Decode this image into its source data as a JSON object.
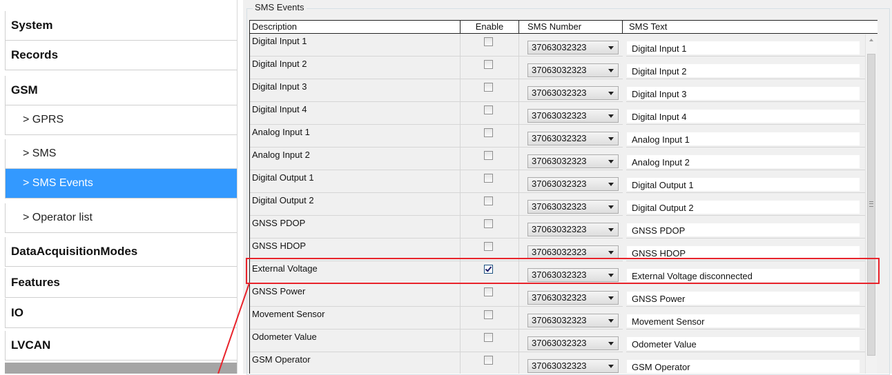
{
  "sidebar": {
    "items": [
      {
        "label": "System",
        "level": "top"
      },
      {
        "label": "Records",
        "level": "top"
      },
      {
        "label": "GSM",
        "level": "top"
      },
      {
        "label": "> GPRS",
        "level": "sub"
      },
      {
        "label": "> SMS",
        "level": "sub"
      },
      {
        "label": "> SMS Events",
        "level": "sub",
        "active": true
      },
      {
        "label": "> Operator list",
        "level": "sub"
      },
      {
        "label": "DataAcquisitionModes",
        "level": "top"
      },
      {
        "label": "Features",
        "level": "top"
      },
      {
        "label": "IO",
        "level": "top"
      },
      {
        "label": "LVCAN",
        "level": "top"
      }
    ]
  },
  "groupbox": {
    "title": "SMS Events"
  },
  "grid": {
    "headers": {
      "description": "Description",
      "enable": "Enable",
      "sms_number": "SMS Number",
      "sms_text": "SMS Text"
    },
    "rows": [
      {
        "description": "Digital Input 1",
        "enabled": false,
        "sms_number": "37063032323",
        "sms_text": "Digital Input 1"
      },
      {
        "description": "Digital Input 2",
        "enabled": false,
        "sms_number": "37063032323",
        "sms_text": "Digital Input 2"
      },
      {
        "description": "Digital Input 3",
        "enabled": false,
        "sms_number": "37063032323",
        "sms_text": "Digital Input 3"
      },
      {
        "description": "Digital Input 4",
        "enabled": false,
        "sms_number": "37063032323",
        "sms_text": "Digital Input 4"
      },
      {
        "description": "Analog Input 1",
        "enabled": false,
        "sms_number": "37063032323",
        "sms_text": "Analog Input 1"
      },
      {
        "description": "Analog Input 2",
        "enabled": false,
        "sms_number": "37063032323",
        "sms_text": "Analog Input 2"
      },
      {
        "description": "Digital Output 1",
        "enabled": false,
        "sms_number": "37063032323",
        "sms_text": "Digital Output 1"
      },
      {
        "description": "Digital Output 2",
        "enabled": false,
        "sms_number": "37063032323",
        "sms_text": "Digital Output 2"
      },
      {
        "description": "GNSS PDOP",
        "enabled": false,
        "sms_number": "37063032323",
        "sms_text": "GNSS PDOP"
      },
      {
        "description": "GNSS HDOP",
        "enabled": false,
        "sms_number": "37063032323",
        "sms_text": "GNSS HDOP"
      },
      {
        "description": "External Voltage",
        "enabled": true,
        "sms_number": "37063032323",
        "sms_text": "External Voltage disconnected"
      },
      {
        "description": "GNSS Power",
        "enabled": false,
        "sms_number": "37063032323",
        "sms_text": "GNSS Power"
      },
      {
        "description": "Movement Sensor",
        "enabled": false,
        "sms_number": "37063032323",
        "sms_text": "Movement Sensor"
      },
      {
        "description": "Odometer Value",
        "enabled": false,
        "sms_number": "37063032323",
        "sms_text": "Odometer Value"
      },
      {
        "description": "GSM Operator",
        "enabled": false,
        "sms_number": "37063032323",
        "sms_text": "GSM Operator"
      }
    ]
  },
  "colors": {
    "accent": "#3399ff",
    "highlight": "#e8232b"
  }
}
